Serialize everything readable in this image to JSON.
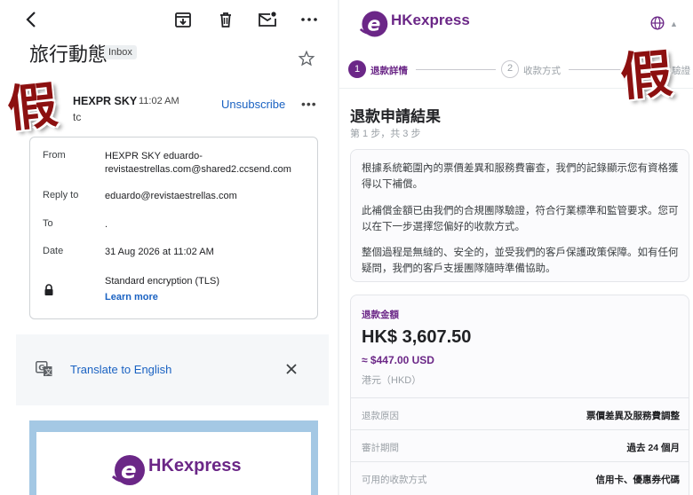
{
  "gmail": {
    "subject": "旅行動態",
    "label": "Inbox",
    "sender": "HEXPR SKY",
    "time": "11:02 AM",
    "to_short": "tc",
    "unsubscribe": "Unsubscribe",
    "more": "•••",
    "details": {
      "from_label": "From",
      "from_value": "HEXPR SKY  eduardo-revistaestrellas.com@shared2.ccsend.com",
      "reply_label": "Reply to",
      "reply_value": "eduardo@revistaestrellas.com",
      "to_label": "To",
      "to_value": ".",
      "date_label": "Date",
      "date_value": "31 Aug 2026 at 11:02 AM",
      "security_value": "Standard encryption (TLS)",
      "learn_more": "Learn more"
    },
    "translate": "Translate to English",
    "email_logo": "HKexpress"
  },
  "stamp": {
    "text": "假",
    "color": "#8c1010"
  },
  "hk": {
    "logo": "HKexpress",
    "brand_color": "#6b2787",
    "steps": [
      {
        "num": "1",
        "label": "退款詳情"
      },
      {
        "num": "2",
        "label": "收款方式"
      },
      {
        "label": "驗證"
      }
    ],
    "title": "退款申請結果",
    "step_info": "第 1 步，共 3 步",
    "paragraphs": [
      "根據系統範圍內的票價差異和服務費審查，我們的記錄顯示您有資格獲得以下補償。",
      "此補償金額已由我們的合規團隊驗證，符合行業標準和監管要求。您可以在下一步選擇您偏好的收款方式。",
      "整個過程是無縫的、安全的，並受我們的客戶保護政策保障。如有任何疑問，我們的客戶支援團隊隨時準備協助。"
    ],
    "amount": {
      "label": "退款金額",
      "main": "HK$ 3,607.50",
      "usd": "≈ $447.00 USD",
      "currency": "港元（HKD）"
    },
    "rows": [
      {
        "k": "退款原因",
        "v": "票價差異及服務費調整"
      },
      {
        "k": "審計期間",
        "v": "過去 24 個月"
      },
      {
        "k": "可用的收款方式",
        "v": "信用卡、優惠券代碼"
      }
    ]
  }
}
